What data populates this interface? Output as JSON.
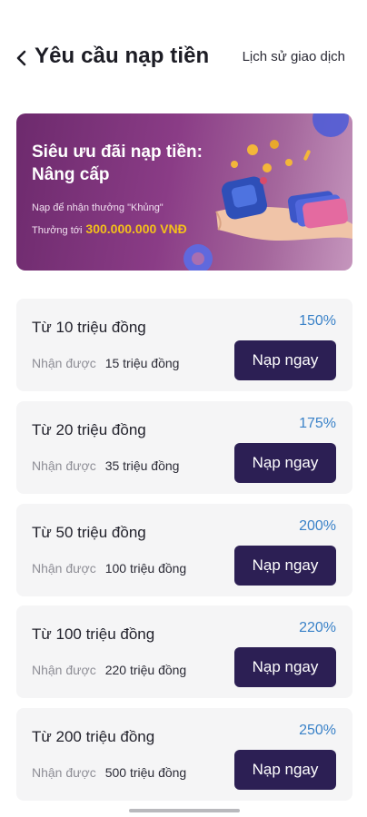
{
  "header": {
    "title": "Yêu cầu nạp tiền",
    "history_link": "Lịch sử giao dịch"
  },
  "banner": {
    "title": "Siêu ưu đãi nạp tiền: Nâng cấp",
    "subtitle": "Nạp để nhận thưởng \"Khủng\"",
    "reward_prefix": "Thưởng tới",
    "reward_amount": "300.000.000 VNĐ",
    "colors": {
      "accent": "#f4c01a",
      "gradient_start": "#6d2a6d",
      "gradient_end": "#c596bd"
    }
  },
  "offers": [
    {
      "title": "Từ 10 triệu đồng",
      "percent": "150%",
      "receive_label": "Nhận được",
      "receive_value": "15 triệu đồng",
      "button": "Nạp ngay"
    },
    {
      "title": "Từ 20 triệu đồng",
      "percent": "175%",
      "receive_label": "Nhận được",
      "receive_value": "35 triệu đồng",
      "button": "Nạp ngay"
    },
    {
      "title": "Từ 50 triệu đồng",
      "percent": "200%",
      "receive_label": "Nhận được",
      "receive_value": "100 triệu đồng",
      "button": "Nạp ngay"
    },
    {
      "title": "Từ 100 triệu đồng",
      "percent": "220%",
      "receive_label": "Nhận được",
      "receive_value": "220 triệu đồng",
      "button": "Nạp ngay"
    },
    {
      "title": "Từ 200 triệu đồng",
      "percent": "250%",
      "receive_label": "Nhận được",
      "receive_value": "500 triệu đồng",
      "button": "Nạp ngay"
    }
  ],
  "colors": {
    "button_bg": "#2c1f54",
    "percent": "#3a82c8",
    "card_bg": "#f5f5f6"
  }
}
